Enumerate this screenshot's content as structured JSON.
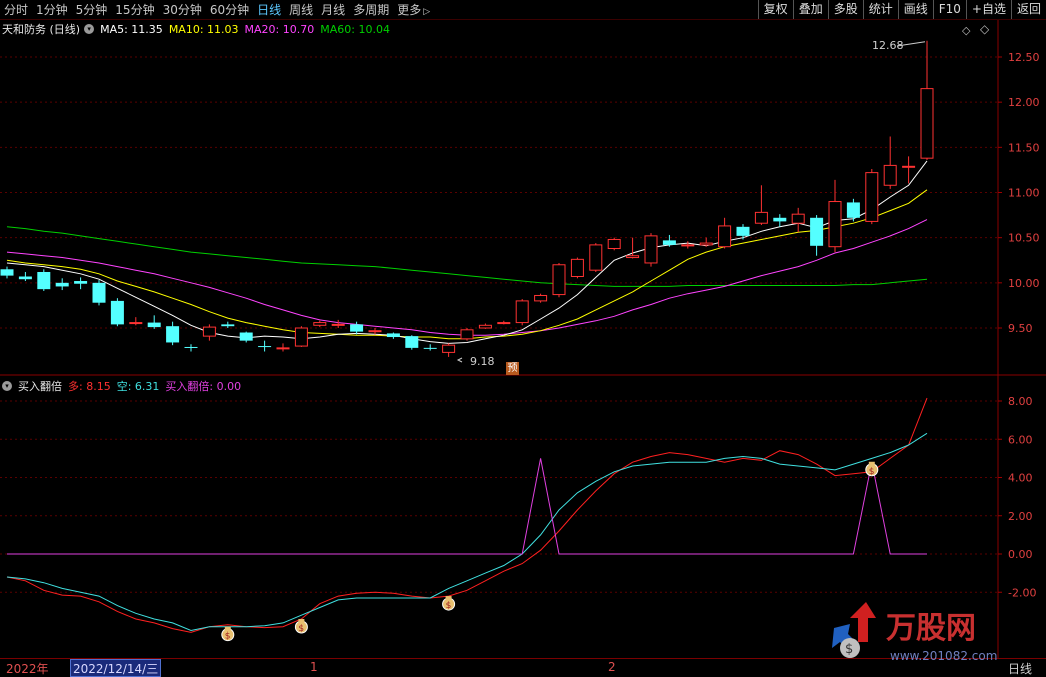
{
  "toolbar": {
    "periods": [
      "分时",
      "1分钟",
      "5分钟",
      "15分钟",
      "30分钟",
      "60分钟",
      "日线",
      "周线",
      "月线",
      "多周期",
      "更多"
    ],
    "active": "日线",
    "right_buttons": [
      "复权",
      "叠加",
      "多股",
      "统计",
      "画线",
      "F10",
      "+自选",
      "返回"
    ]
  },
  "main_legend": {
    "title": "天和防务 (日线)",
    "ma5": "MA5: 11.35",
    "ma10": "MA10: 11.03",
    "ma20": "MA20: 10.70",
    "ma60": "MA60: 10.04"
  },
  "sub_legend": {
    "title": "买入翻倍",
    "duo": "多: 8.15",
    "kong": "空: 6.31",
    "signal": "买入翻倍: 0.00"
  },
  "annotations": {
    "high": "12.68",
    "low": "9.18",
    "badge": "预"
  },
  "bottom_axis": {
    "year": "2022年",
    "cursor_date": "2022/12/14/三",
    "month1": "1",
    "month2": "2",
    "period": "日线"
  },
  "watermark": {
    "name": "万股网",
    "url": "www.201082.com"
  },
  "colors": {
    "up": "#ff3232",
    "down": "#54ffff",
    "ma5": "#ffffff",
    "ma10": "#ffff00",
    "ma20": "#ff44ff",
    "ma60": "#00d000",
    "duo": "#ff2020",
    "kong": "#40e0e0",
    "signal": "#e040e0"
  },
  "chart_data": [
    {
      "type": "candlestick",
      "title": "天和防务 (日线)",
      "y_ticks": [
        9.5,
        10.0,
        10.5,
        11.0,
        11.5,
        12.0,
        12.5
      ],
      "ylim": [
        9.1,
        12.7
      ],
      "candles": [
        {
          "o": 10.15,
          "h": 10.18,
          "l": 10.05,
          "c": 10.08
        },
        {
          "o": 10.07,
          "h": 10.12,
          "l": 10.02,
          "c": 10.04
        },
        {
          "o": 10.12,
          "h": 10.15,
          "l": 9.91,
          "c": 9.93
        },
        {
          "o": 10.0,
          "h": 10.05,
          "l": 9.92,
          "c": 9.96
        },
        {
          "o": 10.02,
          "h": 10.06,
          "l": 9.93,
          "c": 9.99
        },
        {
          "o": 10.0,
          "h": 10.03,
          "l": 9.75,
          "c": 9.78
        },
        {
          "o": 9.8,
          "h": 9.83,
          "l": 9.52,
          "c": 9.54
        },
        {
          "o": 9.56,
          "h": 9.62,
          "l": 9.53,
          "c": 9.56
        },
        {
          "o": 9.56,
          "h": 9.64,
          "l": 9.49,
          "c": 9.51
        },
        {
          "o": 9.52,
          "h": 9.57,
          "l": 9.31,
          "c": 9.34
        },
        {
          "o": 9.29,
          "h": 9.32,
          "l": 9.24,
          "c": 9.28
        },
        {
          "o": 9.41,
          "h": 9.54,
          "l": 9.36,
          "c": 9.51
        },
        {
          "o": 9.54,
          "h": 9.57,
          "l": 9.5,
          "c": 9.52
        },
        {
          "o": 9.45,
          "h": 9.46,
          "l": 9.34,
          "c": 9.36
        },
        {
          "o": 9.3,
          "h": 9.36,
          "l": 9.24,
          "c": 9.29
        },
        {
          "o": 9.28,
          "h": 9.33,
          "l": 9.24,
          "c": 9.28
        },
        {
          "o": 9.3,
          "h": 9.52,
          "l": 9.29,
          "c": 9.5
        },
        {
          "o": 9.53,
          "h": 9.58,
          "l": 9.51,
          "c": 9.56
        },
        {
          "o": 9.54,
          "h": 9.59,
          "l": 9.5,
          "c": 9.54
        },
        {
          "o": 9.54,
          "h": 9.57,
          "l": 9.43,
          "c": 9.46
        },
        {
          "o": 9.46,
          "h": 9.5,
          "l": 9.43,
          "c": 9.47
        },
        {
          "o": 9.44,
          "h": 9.45,
          "l": 9.38,
          "c": 9.4
        },
        {
          "o": 9.41,
          "h": 9.42,
          "l": 9.26,
          "c": 9.28
        },
        {
          "o": 9.28,
          "h": 9.32,
          "l": 9.25,
          "c": 9.27
        },
        {
          "o": 9.23,
          "h": 9.33,
          "l": 9.18,
          "c": 9.31
        },
        {
          "o": 9.38,
          "h": 9.5,
          "l": 9.36,
          "c": 9.48
        },
        {
          "o": 9.5,
          "h": 9.55,
          "l": 9.49,
          "c": 9.53
        },
        {
          "o": 9.55,
          "h": 9.58,
          "l": 9.54,
          "c": 9.56
        },
        {
          "o": 9.56,
          "h": 9.82,
          "l": 9.53,
          "c": 9.8
        },
        {
          "o": 9.8,
          "h": 9.88,
          "l": 9.78,
          "c": 9.86
        },
        {
          "o": 9.87,
          "h": 10.22,
          "l": 9.84,
          "c": 10.2
        },
        {
          "o": 10.07,
          "h": 10.28,
          "l": 10.05,
          "c": 10.26
        },
        {
          "o": 10.14,
          "h": 10.44,
          "l": 10.12,
          "c": 10.42
        },
        {
          "o": 10.38,
          "h": 10.5,
          "l": 10.36,
          "c": 10.48
        },
        {
          "o": 10.28,
          "h": 10.5,
          "l": 10.27,
          "c": 10.3
        },
        {
          "o": 10.22,
          "h": 10.55,
          "l": 10.18,
          "c": 10.52
        },
        {
          "o": 10.47,
          "h": 10.53,
          "l": 10.4,
          "c": 10.42
        },
        {
          "o": 10.42,
          "h": 10.46,
          "l": 10.38,
          "c": 10.42
        },
        {
          "o": 10.42,
          "h": 10.5,
          "l": 10.4,
          "c": 10.44
        },
        {
          "o": 10.4,
          "h": 10.72,
          "l": 10.38,
          "c": 10.63
        },
        {
          "o": 10.62,
          "h": 10.65,
          "l": 10.48,
          "c": 10.52
        },
        {
          "o": 10.66,
          "h": 11.08,
          "l": 10.64,
          "c": 10.78
        },
        {
          "o": 10.72,
          "h": 10.76,
          "l": 10.62,
          "c": 10.68
        },
        {
          "o": 10.66,
          "h": 10.83,
          "l": 10.56,
          "c": 10.76
        },
        {
          "o": 10.72,
          "h": 10.75,
          "l": 10.3,
          "c": 10.41
        },
        {
          "o": 10.4,
          "h": 11.14,
          "l": 10.34,
          "c": 10.9
        },
        {
          "o": 10.89,
          "h": 10.93,
          "l": 10.68,
          "c": 10.72
        },
        {
          "o": 10.68,
          "h": 11.26,
          "l": 10.65,
          "c": 11.22
        },
        {
          "o": 11.08,
          "h": 11.62,
          "l": 11.04,
          "c": 11.3
        },
        {
          "o": 11.28,
          "h": 11.4,
          "l": 11.1,
          "c": 11.29
        },
        {
          "o": 11.38,
          "h": 12.68,
          "l": 11.36,
          "c": 12.15
        }
      ],
      "ma5": [
        10.22,
        10.2,
        10.18,
        10.14,
        10.1,
        10.04,
        9.94,
        9.84,
        9.74,
        9.64,
        9.53,
        9.45,
        9.41,
        9.39,
        9.41,
        9.4,
        9.38,
        9.4,
        9.43,
        9.44,
        9.43,
        9.42,
        9.38,
        9.35,
        9.33,
        9.34,
        9.38,
        9.42,
        9.48,
        9.6,
        9.72,
        9.87,
        10.06,
        10.25,
        10.33,
        10.39,
        10.42,
        10.44,
        10.41,
        10.46,
        10.5,
        10.57,
        10.62,
        10.66,
        10.61,
        10.69,
        10.71,
        10.81,
        10.95,
        11.08,
        11.35
      ],
      "ma10": [
        10.25,
        10.22,
        10.2,
        10.18,
        10.15,
        10.1,
        10.02,
        9.96,
        9.9,
        9.83,
        9.76,
        9.68,
        9.61,
        9.56,
        9.52,
        9.48,
        9.45,
        9.44,
        9.43,
        9.42,
        9.42,
        9.41,
        9.4,
        9.4,
        9.38,
        9.38,
        9.4,
        9.41,
        9.43,
        9.47,
        9.53,
        9.6,
        9.7,
        9.8,
        9.9,
        10.02,
        10.14,
        10.26,
        10.34,
        10.4,
        10.44,
        10.48,
        10.52,
        10.56,
        10.58,
        10.62,
        10.66,
        10.72,
        10.8,
        10.88,
        11.03
      ],
      "ma20": [
        10.34,
        10.32,
        10.3,
        10.28,
        10.25,
        10.22,
        10.18,
        10.14,
        10.1,
        10.05,
        10.0,
        9.95,
        9.89,
        9.83,
        9.76,
        9.7,
        9.64,
        9.59,
        9.56,
        9.54,
        9.52,
        9.5,
        9.48,
        9.45,
        9.43,
        9.42,
        9.42,
        9.43,
        9.45,
        9.47,
        9.5,
        9.54,
        9.58,
        9.63,
        9.7,
        9.76,
        9.83,
        9.88,
        9.92,
        9.96,
        10.02,
        10.08,
        10.13,
        10.18,
        10.25,
        10.33,
        10.38,
        10.45,
        10.52,
        10.6,
        10.7
      ],
      "ma60": [
        10.62,
        10.6,
        10.57,
        10.55,
        10.52,
        10.49,
        10.46,
        10.43,
        10.4,
        10.37,
        10.34,
        10.32,
        10.3,
        10.28,
        10.26,
        10.24,
        10.22,
        10.21,
        10.2,
        10.19,
        10.18,
        10.16,
        10.14,
        10.12,
        10.1,
        10.08,
        10.06,
        10.04,
        10.02,
        10.0,
        9.99,
        9.98,
        9.97,
        9.96,
        9.96,
        9.96,
        9.96,
        9.97,
        9.97,
        9.97,
        9.97,
        9.97,
        9.97,
        9.97,
        9.97,
        9.97,
        9.98,
        9.98,
        10.0,
        10.02,
        10.04
      ]
    },
    {
      "type": "line",
      "title": "买入翻倍",
      "y_ticks": [
        -2.0,
        0.0,
        2.0,
        4.0,
        6.0,
        8.0
      ],
      "ylim": [
        -3.6,
        9.0
      ],
      "series": [
        {
          "name": "多",
          "values": [
            -1.2,
            -1.4,
            -1.9,
            -2.15,
            -2.2,
            -2.5,
            -3.0,
            -3.4,
            -3.6,
            -3.9,
            -4.1,
            -3.8,
            -3.7,
            -3.8,
            -3.85,
            -3.8,
            -3.4,
            -2.6,
            -2.2,
            -2.05,
            -2.0,
            -2.05,
            -2.2,
            -2.3,
            -2.2,
            -1.9,
            -1.4,
            -0.9,
            -0.5,
            0.2,
            1.2,
            2.3,
            3.3,
            4.2,
            4.8,
            5.1,
            5.3,
            5.2,
            5.0,
            4.8,
            5.0,
            4.9,
            5.4,
            5.2,
            4.7,
            4.1,
            4.2,
            4.3,
            5.0,
            5.7,
            8.15
          ]
        },
        {
          "name": "空",
          "values": [
            -1.2,
            -1.3,
            -1.5,
            -1.8,
            -2.0,
            -2.2,
            -2.7,
            -3.1,
            -3.4,
            -3.6,
            -4.0,
            -3.8,
            -3.8,
            -3.8,
            -3.75,
            -3.6,
            -3.2,
            -2.8,
            -2.4,
            -2.3,
            -2.3,
            -2.3,
            -2.3,
            -2.3,
            -1.8,
            -1.4,
            -1.0,
            -0.6,
            0.0,
            1.0,
            2.3,
            3.2,
            3.8,
            4.3,
            4.6,
            4.7,
            4.8,
            4.8,
            4.8,
            5.0,
            5.1,
            5.0,
            4.7,
            4.6,
            4.5,
            4.4,
            4.7,
            5.0,
            5.3,
            5.7,
            6.31
          ]
        },
        {
          "name": "买入翻倍",
          "values": [
            0,
            0,
            0,
            0,
            0,
            0,
            0,
            0,
            0,
            0,
            0,
            0,
            0,
            0,
            0,
            0,
            0,
            0,
            0,
            0,
            0,
            0,
            0,
            0,
            0,
            0,
            0,
            0,
            0,
            5.0,
            0,
            0,
            0,
            0,
            0,
            0,
            0,
            0,
            0,
            0,
            0,
            0,
            0,
            0,
            0,
            0,
            0,
            4.8,
            0,
            0,
            0
          ]
        }
      ],
      "markers": [
        12,
        16,
        24,
        47
      ]
    }
  ]
}
